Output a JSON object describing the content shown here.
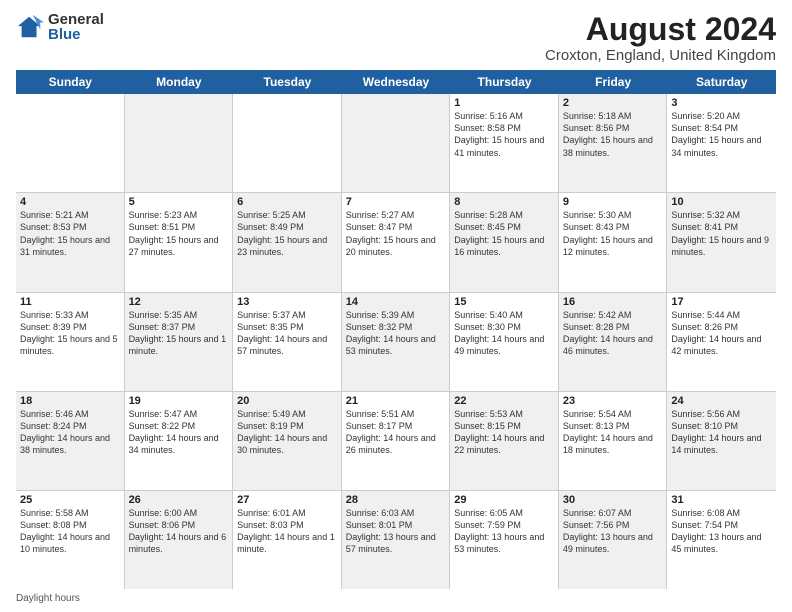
{
  "logo": {
    "general": "General",
    "blue": "Blue"
  },
  "title": "August 2024",
  "location": "Croxton, England, United Kingdom",
  "days_header": [
    "Sunday",
    "Monday",
    "Tuesday",
    "Wednesday",
    "Thursday",
    "Friday",
    "Saturday"
  ],
  "footer_text": "Daylight hours",
  "weeks": [
    [
      {
        "num": "",
        "sunrise": "",
        "sunset": "",
        "daylight": "",
        "shaded": false
      },
      {
        "num": "",
        "sunrise": "",
        "sunset": "",
        "daylight": "",
        "shaded": true
      },
      {
        "num": "",
        "sunrise": "",
        "sunset": "",
        "daylight": "",
        "shaded": false
      },
      {
        "num": "",
        "sunrise": "",
        "sunset": "",
        "daylight": "",
        "shaded": true
      },
      {
        "num": "1",
        "sunrise": "Sunrise: 5:16 AM",
        "sunset": "Sunset: 8:58 PM",
        "daylight": "Daylight: 15 hours and 41 minutes.",
        "shaded": false
      },
      {
        "num": "2",
        "sunrise": "Sunrise: 5:18 AM",
        "sunset": "Sunset: 8:56 PM",
        "daylight": "Daylight: 15 hours and 38 minutes.",
        "shaded": true
      },
      {
        "num": "3",
        "sunrise": "Sunrise: 5:20 AM",
        "sunset": "Sunset: 8:54 PM",
        "daylight": "Daylight: 15 hours and 34 minutes.",
        "shaded": false
      }
    ],
    [
      {
        "num": "4",
        "sunrise": "Sunrise: 5:21 AM",
        "sunset": "Sunset: 8:53 PM",
        "daylight": "Daylight: 15 hours and 31 minutes.",
        "shaded": true
      },
      {
        "num": "5",
        "sunrise": "Sunrise: 5:23 AM",
        "sunset": "Sunset: 8:51 PM",
        "daylight": "Daylight: 15 hours and 27 minutes.",
        "shaded": false
      },
      {
        "num": "6",
        "sunrise": "Sunrise: 5:25 AM",
        "sunset": "Sunset: 8:49 PM",
        "daylight": "Daylight: 15 hours and 23 minutes.",
        "shaded": true
      },
      {
        "num": "7",
        "sunrise": "Sunrise: 5:27 AM",
        "sunset": "Sunset: 8:47 PM",
        "daylight": "Daylight: 15 hours and 20 minutes.",
        "shaded": false
      },
      {
        "num": "8",
        "sunrise": "Sunrise: 5:28 AM",
        "sunset": "Sunset: 8:45 PM",
        "daylight": "Daylight: 15 hours and 16 minutes.",
        "shaded": true
      },
      {
        "num": "9",
        "sunrise": "Sunrise: 5:30 AM",
        "sunset": "Sunset: 8:43 PM",
        "daylight": "Daylight: 15 hours and 12 minutes.",
        "shaded": false
      },
      {
        "num": "10",
        "sunrise": "Sunrise: 5:32 AM",
        "sunset": "Sunset: 8:41 PM",
        "daylight": "Daylight: 15 hours and 9 minutes.",
        "shaded": true
      }
    ],
    [
      {
        "num": "11",
        "sunrise": "Sunrise: 5:33 AM",
        "sunset": "Sunset: 8:39 PM",
        "daylight": "Daylight: 15 hours and 5 minutes.",
        "shaded": false
      },
      {
        "num": "12",
        "sunrise": "Sunrise: 5:35 AM",
        "sunset": "Sunset: 8:37 PM",
        "daylight": "Daylight: 15 hours and 1 minute.",
        "shaded": true
      },
      {
        "num": "13",
        "sunrise": "Sunrise: 5:37 AM",
        "sunset": "Sunset: 8:35 PM",
        "daylight": "Daylight: 14 hours and 57 minutes.",
        "shaded": false
      },
      {
        "num": "14",
        "sunrise": "Sunrise: 5:39 AM",
        "sunset": "Sunset: 8:32 PM",
        "daylight": "Daylight: 14 hours and 53 minutes.",
        "shaded": true
      },
      {
        "num": "15",
        "sunrise": "Sunrise: 5:40 AM",
        "sunset": "Sunset: 8:30 PM",
        "daylight": "Daylight: 14 hours and 49 minutes.",
        "shaded": false
      },
      {
        "num": "16",
        "sunrise": "Sunrise: 5:42 AM",
        "sunset": "Sunset: 8:28 PM",
        "daylight": "Daylight: 14 hours and 46 minutes.",
        "shaded": true
      },
      {
        "num": "17",
        "sunrise": "Sunrise: 5:44 AM",
        "sunset": "Sunset: 8:26 PM",
        "daylight": "Daylight: 14 hours and 42 minutes.",
        "shaded": false
      }
    ],
    [
      {
        "num": "18",
        "sunrise": "Sunrise: 5:46 AM",
        "sunset": "Sunset: 8:24 PM",
        "daylight": "Daylight: 14 hours and 38 minutes.",
        "shaded": true
      },
      {
        "num": "19",
        "sunrise": "Sunrise: 5:47 AM",
        "sunset": "Sunset: 8:22 PM",
        "daylight": "Daylight: 14 hours and 34 minutes.",
        "shaded": false
      },
      {
        "num": "20",
        "sunrise": "Sunrise: 5:49 AM",
        "sunset": "Sunset: 8:19 PM",
        "daylight": "Daylight: 14 hours and 30 minutes.",
        "shaded": true
      },
      {
        "num": "21",
        "sunrise": "Sunrise: 5:51 AM",
        "sunset": "Sunset: 8:17 PM",
        "daylight": "Daylight: 14 hours and 26 minutes.",
        "shaded": false
      },
      {
        "num": "22",
        "sunrise": "Sunrise: 5:53 AM",
        "sunset": "Sunset: 8:15 PM",
        "daylight": "Daylight: 14 hours and 22 minutes.",
        "shaded": true
      },
      {
        "num": "23",
        "sunrise": "Sunrise: 5:54 AM",
        "sunset": "Sunset: 8:13 PM",
        "daylight": "Daylight: 14 hours and 18 minutes.",
        "shaded": false
      },
      {
        "num": "24",
        "sunrise": "Sunrise: 5:56 AM",
        "sunset": "Sunset: 8:10 PM",
        "daylight": "Daylight: 14 hours and 14 minutes.",
        "shaded": true
      }
    ],
    [
      {
        "num": "25",
        "sunrise": "Sunrise: 5:58 AM",
        "sunset": "Sunset: 8:08 PM",
        "daylight": "Daylight: 14 hours and 10 minutes.",
        "shaded": false
      },
      {
        "num": "26",
        "sunrise": "Sunrise: 6:00 AM",
        "sunset": "Sunset: 8:06 PM",
        "daylight": "Daylight: 14 hours and 6 minutes.",
        "shaded": true
      },
      {
        "num": "27",
        "sunrise": "Sunrise: 6:01 AM",
        "sunset": "Sunset: 8:03 PM",
        "daylight": "Daylight: 14 hours and 1 minute.",
        "shaded": false
      },
      {
        "num": "28",
        "sunrise": "Sunrise: 6:03 AM",
        "sunset": "Sunset: 8:01 PM",
        "daylight": "Daylight: 13 hours and 57 minutes.",
        "shaded": true
      },
      {
        "num": "29",
        "sunrise": "Sunrise: 6:05 AM",
        "sunset": "Sunset: 7:59 PM",
        "daylight": "Daylight: 13 hours and 53 minutes.",
        "shaded": false
      },
      {
        "num": "30",
        "sunrise": "Sunrise: 6:07 AM",
        "sunset": "Sunset: 7:56 PM",
        "daylight": "Daylight: 13 hours and 49 minutes.",
        "shaded": true
      },
      {
        "num": "31",
        "sunrise": "Sunrise: 6:08 AM",
        "sunset": "Sunset: 7:54 PM",
        "daylight": "Daylight: 13 hours and 45 minutes.",
        "shaded": false
      }
    ]
  ]
}
